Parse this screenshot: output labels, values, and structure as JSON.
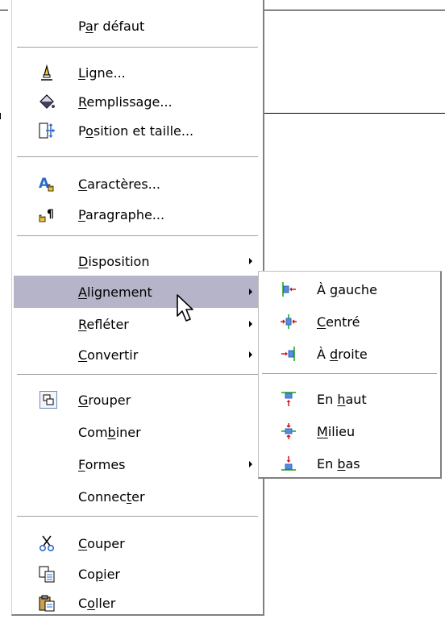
{
  "context_menu": {
    "items": [
      {
        "pre": "P",
        "acc": "a",
        "post": "r défaut"
      },
      {
        "pre": "",
        "acc": "L",
        "post": "igne...",
        "icon": "line-pen-icon"
      },
      {
        "pre": "",
        "acc": "R",
        "post": "emplissage...",
        "icon": "paint-bucket-icon"
      },
      {
        "pre": "P",
        "acc": "o",
        "post": "sition et taille...",
        "icon": "position-size-icon"
      },
      {
        "pre": "",
        "acc": "C",
        "post": "aractères...",
        "icon": "character-icon"
      },
      {
        "pre": "",
        "acc": "P",
        "post": "aragraphe...",
        "icon": "paragraph-icon"
      },
      {
        "pre": "",
        "acc": "D",
        "post": "isposition",
        "submenu": true
      },
      {
        "pre": "",
        "acc": "A",
        "post": "lignement",
        "submenu": true,
        "highlighted": true
      },
      {
        "pre": "",
        "acc": "R",
        "post": "efléter",
        "submenu": true
      },
      {
        "pre": "",
        "acc": "C",
        "post": "onvertir",
        "submenu": true
      },
      {
        "pre": "",
        "acc": "G",
        "post": "rouper",
        "icon": "group-icon"
      },
      {
        "pre": "Com",
        "acc": "b",
        "post": "iner"
      },
      {
        "pre": "",
        "acc": "F",
        "post": "ormes",
        "submenu": true
      },
      {
        "pre": "Connec",
        "acc": "t",
        "post": "er"
      },
      {
        "pre": "",
        "acc": "C",
        "post": "ouper",
        "icon": "scissors-icon"
      },
      {
        "pre": "Co",
        "acc": "p",
        "post": "ier",
        "icon": "copy-icon"
      },
      {
        "pre": "C",
        "acc": "o",
        "post": "ller",
        "icon": "paste-icon"
      }
    ]
  },
  "alignment_submenu": {
    "items": [
      {
        "pre": "À ",
        "acc": "g",
        "post": "auche",
        "icon": "align-left-icon"
      },
      {
        "pre": "",
        "acc": "C",
        "post": "entré",
        "icon": "align-center-icon"
      },
      {
        "pre": "À ",
        "acc": "d",
        "post": "roite",
        "icon": "align-right-icon"
      },
      {
        "pre": "En ",
        "acc": "h",
        "post": "aut",
        "icon": "align-top-icon"
      },
      {
        "pre": "",
        "acc": "M",
        "post": "ilieu",
        "icon": "align-middle-icon"
      },
      {
        "pre": "En ",
        "acc": "b",
        "post": "as",
        "icon": "align-bottom-icon"
      }
    ]
  },
  "colors": {
    "highlight": "#b6b4c8",
    "separator": "#a0a0a0",
    "align_icon_red": "#d01818",
    "align_icon_blue": "#2a6ac8",
    "align_icon_green": "#18a018"
  }
}
